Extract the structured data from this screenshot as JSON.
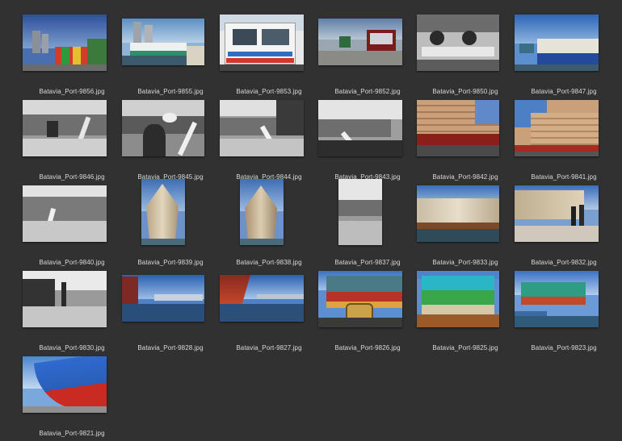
{
  "thumbnails": [
    {
      "filename": "Batavia_Port-9856.jpg"
    },
    {
      "filename": "Batavia_Port-9855.jpg"
    },
    {
      "filename": "Batavia_Port-9853.jpg"
    },
    {
      "filename": "Batavia_Port-9852.jpg"
    },
    {
      "filename": "Batavia_Port-9850.jpg"
    },
    {
      "filename": "Batavia_Port-9847.jpg"
    },
    {
      "filename": "Batavia_Port-9846.jpg"
    },
    {
      "filename": "Batavia_Port-9845.jpg"
    },
    {
      "filename": "Batavia_Port-9844.jpg"
    },
    {
      "filename": "Batavia_Port-9843.jpg"
    },
    {
      "filename": "Batavia_Port-9842.jpg"
    },
    {
      "filename": "Batavia_Port-9841.jpg"
    },
    {
      "filename": "Batavia_Port-9840.jpg"
    },
    {
      "filename": "Batavia_Port-9839.jpg"
    },
    {
      "filename": "Batavia_Port-9838.jpg"
    },
    {
      "filename": "Batavia_Port-9837.jpg"
    },
    {
      "filename": "Batavia_Port-9833.jpg"
    },
    {
      "filename": "Batavia_Port-9832.jpg"
    },
    {
      "filename": "Batavia_Port-9830.jpg"
    },
    {
      "filename": "Batavia_Port-9828.jpg"
    },
    {
      "filename": "Batavia_Port-9827.jpg"
    },
    {
      "filename": "Batavia_Port-9826.jpg"
    },
    {
      "filename": "Batavia_Port-9825.jpg"
    },
    {
      "filename": "Batavia_Port-9823.jpg"
    },
    {
      "filename": "Batavia_Port-9821.jpg"
    }
  ]
}
